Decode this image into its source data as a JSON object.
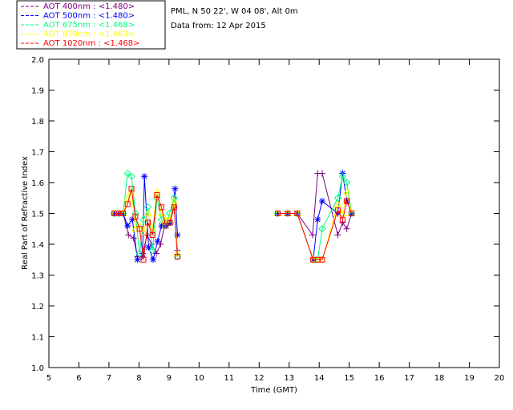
{
  "header": {
    "site_line": "PML, N 50 22', W 04 08', Alt 0m",
    "date_line": "Data from: 12 Apr 2015"
  },
  "chart_data": {
    "type": "scatter",
    "title": "",
    "xlabel": "Time (GMT)",
    "ylabel": "Real Part of Refractive Index",
    "xlim": [
      5,
      20
    ],
    "ylim": [
      1.0,
      2.0
    ],
    "xticks": [
      5,
      6,
      7,
      8,
      9,
      10,
      11,
      12,
      13,
      14,
      15,
      16,
      17,
      18,
      19,
      20
    ],
    "yticks": [
      "1.0",
      "1.1",
      "1.2",
      "1.3",
      "1.4",
      "1.5",
      "1.6",
      "1.7",
      "1.8",
      "1.9",
      "2.0"
    ],
    "grid": false,
    "legend_position": "top-left outside",
    "series": [
      {
        "name": "AOT  400nm : <1.480>",
        "color": "#800080",
        "marker": "plus",
        "points": [
          [
            7.18,
            1.5
          ],
          [
            7.33,
            1.5
          ],
          [
            7.47,
            1.5
          ],
          [
            7.65,
            1.43
          ],
          [
            7.82,
            1.42
          ],
          [
            7.95,
            1.36
          ],
          [
            8.1,
            1.36
          ],
          [
            8.27,
            1.43
          ],
          [
            8.42,
            1.4
          ],
          [
            8.58,
            1.37
          ],
          [
            8.72,
            1.4
          ],
          [
            8.87,
            1.47
          ],
          [
            9.02,
            1.47
          ],
          [
            9.17,
            1.52
          ],
          [
            9.28,
            1.38
          ],
          [
            12.62,
            1.5
          ],
          [
            12.95,
            1.5
          ],
          [
            13.27,
            1.5
          ],
          [
            13.78,
            1.43
          ],
          [
            13.95,
            1.63
          ],
          [
            14.1,
            1.63
          ],
          [
            14.62,
            1.43
          ],
          [
            14.78,
            1.47
          ],
          [
            14.92,
            1.45
          ],
          [
            15.08,
            1.5
          ]
        ]
      },
      {
        "name": "AOT  500nm : <1.480>",
        "color": "#0000ff",
        "marker": "asterisk",
        "points": [
          [
            7.18,
            1.5
          ],
          [
            7.33,
            1.5
          ],
          [
            7.47,
            1.5
          ],
          [
            7.62,
            1.46
          ],
          [
            7.78,
            1.48
          ],
          [
            7.95,
            1.35
          ],
          [
            8.12,
            1.37
          ],
          [
            8.18,
            1.62
          ],
          [
            8.32,
            1.39
          ],
          [
            8.47,
            1.35
          ],
          [
            8.62,
            1.41
          ],
          [
            8.75,
            1.46
          ],
          [
            8.9,
            1.46
          ],
          [
            9.05,
            1.47
          ],
          [
            9.2,
            1.58
          ],
          [
            9.28,
            1.43
          ],
          [
            12.62,
            1.5
          ],
          [
            12.95,
            1.5
          ],
          [
            13.27,
            1.5
          ],
          [
            13.8,
            1.35
          ],
          [
            13.95,
            1.48
          ],
          [
            14.1,
            1.54
          ],
          [
            14.62,
            1.5
          ],
          [
            14.78,
            1.63
          ],
          [
            14.92,
            1.54
          ],
          [
            15.08,
            1.5
          ]
        ]
      },
      {
        "name": "AOT  675nm : <1.468>",
        "color": "#00ff7f",
        "marker": "diamond",
        "points": [
          [
            7.18,
            1.5
          ],
          [
            7.33,
            1.5
          ],
          [
            7.47,
            1.5
          ],
          [
            7.62,
            1.63
          ],
          [
            7.75,
            1.62
          ],
          [
            7.88,
            1.5
          ],
          [
            8.02,
            1.37
          ],
          [
            8.15,
            1.48
          ],
          [
            8.3,
            1.52
          ],
          [
            8.45,
            1.38
          ],
          [
            8.6,
            1.55
          ],
          [
            8.75,
            1.48
          ],
          [
            8.88,
            1.46
          ],
          [
            9.02,
            1.5
          ],
          [
            9.17,
            1.55
          ],
          [
            9.28,
            1.36
          ],
          [
            12.62,
            1.5
          ],
          [
            12.95,
            1.5
          ],
          [
            13.27,
            1.5
          ],
          [
            13.8,
            1.35
          ],
          [
            13.95,
            1.35
          ],
          [
            14.1,
            1.45
          ],
          [
            14.62,
            1.55
          ],
          [
            14.78,
            1.62
          ],
          [
            14.92,
            1.6
          ],
          [
            15.08,
            1.5
          ]
        ]
      },
      {
        "name": "AOT  870nm : <1.463>",
        "color": "#ffff00",
        "marker": "triangle",
        "points": [
          [
            7.18,
            1.5
          ],
          [
            7.33,
            1.5
          ],
          [
            7.47,
            1.5
          ],
          [
            7.62,
            1.55
          ],
          [
            7.75,
            1.57
          ],
          [
            7.88,
            1.45
          ],
          [
            8.02,
            1.46
          ],
          [
            8.15,
            1.44
          ],
          [
            8.3,
            1.5
          ],
          [
            8.45,
            1.45
          ],
          [
            8.6,
            1.57
          ],
          [
            8.75,
            1.5
          ],
          [
            8.88,
            1.48
          ],
          [
            9.02,
            1.48
          ],
          [
            9.17,
            1.54
          ],
          [
            9.28,
            1.37
          ],
          [
            12.62,
            1.5
          ],
          [
            12.95,
            1.5
          ],
          [
            13.27,
            1.5
          ],
          [
            13.8,
            1.35
          ],
          [
            13.95,
            1.35
          ],
          [
            14.1,
            1.35
          ],
          [
            14.62,
            1.53
          ],
          [
            14.78,
            1.5
          ],
          [
            14.92,
            1.57
          ],
          [
            15.08,
            1.5
          ]
        ]
      },
      {
        "name": "AOT 1020nm : <1.468>",
        "color": "#ff0000",
        "marker": "square",
        "points": [
          [
            7.18,
            1.5
          ],
          [
            7.33,
            1.5
          ],
          [
            7.47,
            1.5
          ],
          [
            7.62,
            1.53
          ],
          [
            7.75,
            1.58
          ],
          [
            7.88,
            1.49
          ],
          [
            8.02,
            1.45
          ],
          [
            8.15,
            1.35
          ],
          [
            8.3,
            1.47
          ],
          [
            8.45,
            1.43
          ],
          [
            8.6,
            1.56
          ],
          [
            8.75,
            1.52
          ],
          [
            8.88,
            1.46
          ],
          [
            9.02,
            1.47
          ],
          [
            9.17,
            1.52
          ],
          [
            9.28,
            1.36
          ],
          [
            12.62,
            1.5
          ],
          [
            12.95,
            1.5
          ],
          [
            13.27,
            1.5
          ],
          [
            13.8,
            1.35
          ],
          [
            13.95,
            1.35
          ],
          [
            14.1,
            1.35
          ],
          [
            14.62,
            1.51
          ],
          [
            14.78,
            1.48
          ],
          [
            14.92,
            1.54
          ],
          [
            15.08,
            1.5
          ]
        ]
      }
    ]
  }
}
